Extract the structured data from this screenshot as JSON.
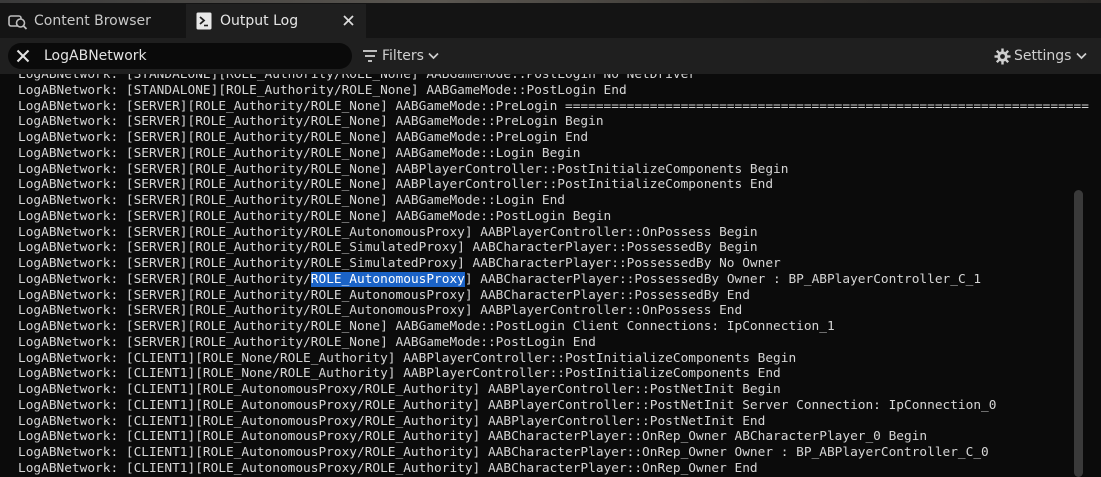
{
  "tabs": [
    {
      "label": "Content Browser",
      "icon": "content-browser-icon"
    },
    {
      "label": "Output Log",
      "icon": "output-log-icon"
    }
  ],
  "toolbar": {
    "search_value": "LogABNetwork",
    "filters_label": "Filters",
    "settings_label": "Settings"
  },
  "colors": {
    "selection": "#1b63c7",
    "background": "#0b0b0b",
    "panel": "#1f1f1f"
  },
  "log": {
    "lines": [
      {
        "text": "LogABNetwork: [STANDALONE][ROLE_Authority/ROLE_None] AABGameMode::PostLogin No NetDriver"
      },
      {
        "text": "LogABNetwork: [STANDALONE][ROLE_Authority/ROLE_None] AABGameMode::PostLogin End"
      },
      {
        "text": "LogABNetwork: [SERVER][ROLE_Authority/ROLE_None] AABGameMode::PreLogin ===================================================================="
      },
      {
        "text": "LogABNetwork: [SERVER][ROLE_Authority/ROLE_None] AABGameMode::PreLogin Begin"
      },
      {
        "text": "LogABNetwork: [SERVER][ROLE_Authority/ROLE_None] AABGameMode::PreLogin End"
      },
      {
        "text": "LogABNetwork: [SERVER][ROLE_Authority/ROLE_None] AABGameMode::Login Begin"
      },
      {
        "text": "LogABNetwork: [SERVER][ROLE_Authority/ROLE_None] AABPlayerController::PostInitializeComponents Begin"
      },
      {
        "text": "LogABNetwork: [SERVER][ROLE_Authority/ROLE_None] AABPlayerController::PostInitializeComponents End"
      },
      {
        "text": "LogABNetwork: [SERVER][ROLE_Authority/ROLE_None] AABGameMode::Login End"
      },
      {
        "text": "LogABNetwork: [SERVER][ROLE_Authority/ROLE_None] AABGameMode::PostLogin Begin"
      },
      {
        "text": "LogABNetwork: [SERVER][ROLE_Authority/ROLE_AutonomousProxy] AABPlayerController::OnPossess Begin"
      },
      {
        "text": "LogABNetwork: [SERVER][ROLE_Authority/ROLE_SimulatedProxy] AABCharacterPlayer::PossessedBy Begin"
      },
      {
        "text": "LogABNetwork: [SERVER][ROLE_Authority/ROLE_SimulatedProxy] AABCharacterPlayer::PossessedBy No Owner"
      },
      {
        "pre": "LogABNetwork: [SERVER][ROLE_Authority/",
        "hl": "ROLE_AutonomousProxy",
        "post": "] AABCharacterPlayer::PossessedBy Owner : BP_ABPlayerController_C_1"
      },
      {
        "text": "LogABNetwork: [SERVER][ROLE_Authority/ROLE_AutonomousProxy] AABCharacterPlayer::PossessedBy End"
      },
      {
        "text": "LogABNetwork: [SERVER][ROLE_Authority/ROLE_AutonomousProxy] AABPlayerController::OnPossess End"
      },
      {
        "text": "LogABNetwork: [SERVER][ROLE_Authority/ROLE_None] AABGameMode::PostLogin Client Connections: IpConnection_1"
      },
      {
        "text": "LogABNetwork: [SERVER][ROLE_Authority/ROLE_None] AABGameMode::PostLogin End"
      },
      {
        "text": "LogABNetwork: [CLIENT1][ROLE_None/ROLE_Authority] AABPlayerController::PostInitializeComponents Begin"
      },
      {
        "text": "LogABNetwork: [CLIENT1][ROLE_None/ROLE_Authority] AABPlayerController::PostInitializeComponents End"
      },
      {
        "text": "LogABNetwork: [CLIENT1][ROLE_AutonomousProxy/ROLE_Authority] AABPlayerController::PostNetInit Begin"
      },
      {
        "text": "LogABNetwork: [CLIENT1][ROLE_AutonomousProxy/ROLE_Authority] AABPlayerController::PostNetInit Server Connection: IpConnection_0"
      },
      {
        "text": "LogABNetwork: [CLIENT1][ROLE_AutonomousProxy/ROLE_Authority] AABPlayerController::PostNetInit End"
      },
      {
        "text": "LogABNetwork: [CLIENT1][ROLE_AutonomousProxy/ROLE_Authority] AABCharacterPlayer::OnRep_Owner ABCharacterPlayer_0 Begin"
      },
      {
        "text": "LogABNetwork: [CLIENT1][ROLE_AutonomousProxy/ROLE_Authority] AABCharacterPlayer::OnRep_Owner Owner : BP_ABPlayerController_C_0"
      },
      {
        "text": "LogABNetwork: [CLIENT1][ROLE_AutonomousProxy/ROLE_Authority] AABCharacterPlayer::OnRep_Owner End"
      }
    ]
  }
}
